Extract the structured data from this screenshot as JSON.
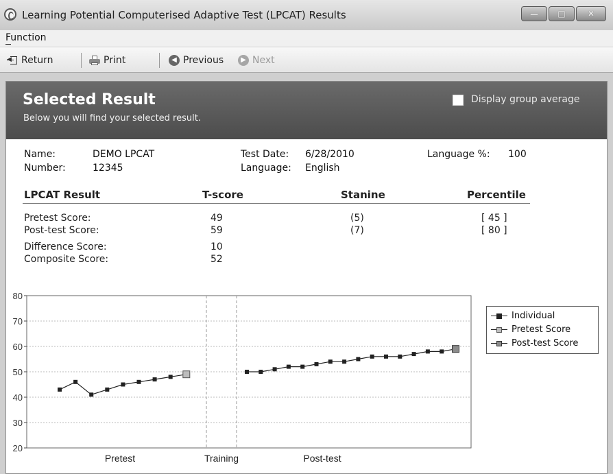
{
  "window": {
    "title": "Learning  Potential Computerised Adaptive Test (LPCAT) Results"
  },
  "menu": {
    "function": "Function"
  },
  "toolbar": {
    "return": "Return",
    "print": "Print",
    "previous": "Previous",
    "next": "Next"
  },
  "header": {
    "title": "Selected Result",
    "subtitle": "Below you will find your selected result.",
    "group_avg_label": "Display group average",
    "group_avg_checked": false
  },
  "info": {
    "name_label": "Name:",
    "name_value": "DEMO LPCAT",
    "number_label": "Number:",
    "number_value": "12345",
    "test_date_label": "Test Date:",
    "test_date_value": "6/28/2010",
    "language_label": "Language:",
    "language_value": "English",
    "language_pct_label": "Language %:",
    "language_pct_value": "100"
  },
  "results": {
    "headers": [
      "LPCAT Result",
      "T-score",
      "Stanine",
      "Percentile"
    ],
    "rows": [
      {
        "label": "Pretest Score:",
        "tscore": "49",
        "stanine": "(5)",
        "percentile": "[ 45 ]"
      },
      {
        "label": "Post-test Score:",
        "tscore": "59",
        "stanine": "(7)",
        "percentile": "[ 80 ]"
      },
      {
        "label": "Difference Score:",
        "tscore": "10",
        "stanine": "",
        "percentile": ""
      },
      {
        "label": "Composite Score:",
        "tscore": "52",
        "stanine": "",
        "percentile": ""
      }
    ]
  },
  "chart_data": {
    "type": "line",
    "ylim": [
      20,
      80
    ],
    "yticks": [
      "20",
      "30",
      "40",
      "50",
      "60",
      "70",
      "80"
    ],
    "sections": [
      "Pretest",
      "Training",
      "Post-test"
    ],
    "grid": true,
    "legend_placement": "right",
    "series": [
      {
        "name": "Individual",
        "pretest": [
          43,
          46,
          41,
          43,
          45,
          46,
          47,
          48
        ],
        "posttest": [
          50,
          50,
          51,
          52,
          52,
          53,
          54,
          54,
          55,
          56,
          56,
          56,
          57,
          58,
          58
        ]
      },
      {
        "name": "Pretest Score",
        "value": 49
      },
      {
        "name": "Post-test Score",
        "value": 59
      }
    ]
  }
}
